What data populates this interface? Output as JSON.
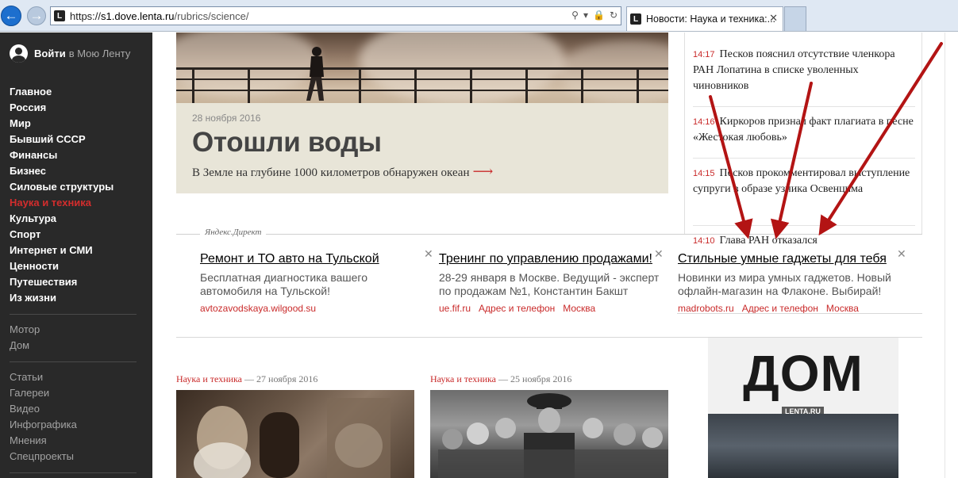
{
  "browser": {
    "url_scheme": "https://",
    "url_host": "s1.dove.lenta.ru",
    "url_path": "/rubrics/science/",
    "tab_title": "Новости: Наука и техника:...",
    "favicon_letter": "L",
    "close_glyph": "✕"
  },
  "sidebar": {
    "login_label": "Войти",
    "login_suffix": "в Мою Ленту",
    "menu_main": [
      "Главное",
      "Россия",
      "Мир",
      "Бывший СССР",
      "Финансы",
      "Бизнес",
      "Силовые структуры",
      "Наука и техника",
      "Культура",
      "Спорт",
      "Интернет и СМИ",
      "Ценности",
      "Путешествия",
      "Из жизни"
    ],
    "active_item": "Наука и техника",
    "menu_projects": [
      "Мотор",
      "Дом"
    ],
    "menu_formats": [
      "Статьи",
      "Галереи",
      "Видео",
      "Инфографика",
      "Мнения",
      "Спецпроекты"
    ]
  },
  "hero": {
    "date": "28 ноября 2016",
    "title": "Отошли воды",
    "subtitle": "В Земле на глубине 1000 километров обнаружен океан",
    "arrow": "⟶"
  },
  "news": [
    {
      "time": "14:17",
      "text": "Песков пояснил отсутствие членкора РАН Лопатина в списке уволенных чиновников"
    },
    {
      "time": "14:16",
      "text": "Киркоров признал факт плагиата в песне «Жестокая любовь»"
    },
    {
      "time": "14:15",
      "text": "Песков прокомментировал выступление супруги в образе узника Освенцима"
    },
    {
      "time": "14:10",
      "text": "Глава РАН отказался"
    }
  ],
  "direct": {
    "label": "Яндекс.Директ",
    "ads": [
      {
        "title": "Ремонт и ТО авто на Тульской",
        "text": "Бесплатная диагностика вашего автомобиля на Тульской!",
        "links": [
          "avtozavodskaya.wilgood.su"
        ]
      },
      {
        "title": "Тренинг по управлению продажами!",
        "text": "28-29 января в Москве. Ведущий - эксперт по продажам №1, Константин Бакшт",
        "links": [
          "ue.fif.ru",
          "Адрес и телефон",
          "Москва"
        ]
      },
      {
        "title": "Стильные умные гаджеты для тебя",
        "text": "Новинки из мира умных гаджетов. Новый офлайн-магазин на Флаконе. Выбирай!",
        "links": [
          "madrobots.ru",
          "Адрес и телефон",
          "Москва"
        ]
      }
    ]
  },
  "cards": [
    {
      "rubric": "Наука и техника",
      "date": "— 27 ноября 2016"
    },
    {
      "rubric": "Наука и техника",
      "date": "— 25 ноября 2016"
    }
  ],
  "promo": {
    "word": "ДОМ",
    "badge": "LENTA.RU"
  },
  "colors": {
    "accent": "#c92a2a",
    "sidebar_bg": "#292929",
    "annotation_arrow": "#b31414"
  }
}
